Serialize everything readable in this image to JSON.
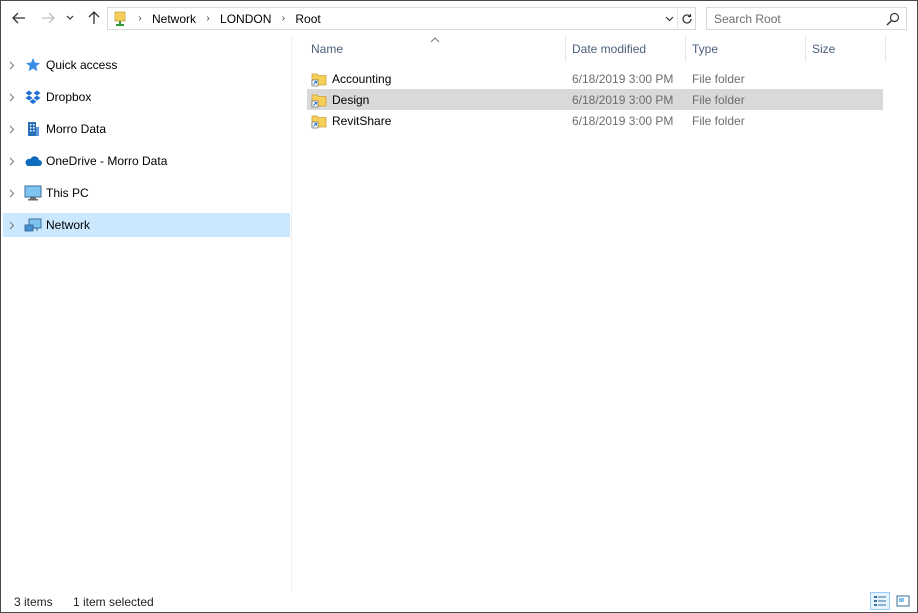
{
  "address": {
    "crumbs": [
      "Network",
      "LONDON",
      "Root"
    ]
  },
  "search": {
    "placeholder": "Search Root"
  },
  "nav": {
    "items": [
      {
        "label": "Quick access",
        "icon": "star-icon"
      },
      {
        "label": "Dropbox",
        "icon": "dropbox-icon"
      },
      {
        "label": "Morro Data",
        "icon": "building-icon"
      },
      {
        "label": "OneDrive - Morro Data",
        "icon": "cloud-icon"
      },
      {
        "label": "This PC",
        "icon": "monitor-icon"
      },
      {
        "label": "Network",
        "icon": "network-icon",
        "selected": true
      }
    ]
  },
  "columns": {
    "name": "Name",
    "date": "Date modified",
    "type": "Type",
    "size": "Size"
  },
  "files": [
    {
      "name": "Accounting",
      "date": "6/18/2019 3:00 PM",
      "type": "File folder",
      "selected": false
    },
    {
      "name": "Design",
      "date": "6/18/2019 3:00 PM",
      "type": "File folder",
      "selected": true
    },
    {
      "name": "RevitShare",
      "date": "6/18/2019 3:00 PM",
      "type": "File folder",
      "selected": false
    }
  ],
  "status": {
    "count": "3 items",
    "selection": "1 item selected"
  },
  "colors": {
    "nav_selected": "#cce8ff",
    "row_selected": "#d9d9d9",
    "header_text": "#4c607a",
    "folder": "#f5cf5a"
  }
}
